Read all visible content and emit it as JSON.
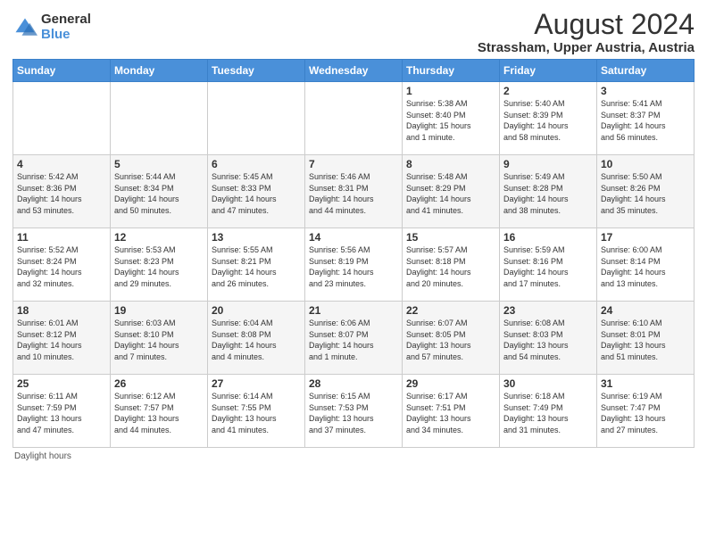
{
  "logo": {
    "general": "General",
    "blue": "Blue"
  },
  "title": "August 2024",
  "subtitle": "Strassham, Upper Austria, Austria",
  "days_of_week": [
    "Sunday",
    "Monday",
    "Tuesday",
    "Wednesday",
    "Thursday",
    "Friday",
    "Saturday"
  ],
  "footer": "Daylight hours",
  "weeks": [
    [
      {
        "day": "",
        "info": ""
      },
      {
        "day": "",
        "info": ""
      },
      {
        "day": "",
        "info": ""
      },
      {
        "day": "",
        "info": ""
      },
      {
        "day": "1",
        "info": "Sunrise: 5:38 AM\nSunset: 8:40 PM\nDaylight: 15 hours\nand 1 minute."
      },
      {
        "day": "2",
        "info": "Sunrise: 5:40 AM\nSunset: 8:39 PM\nDaylight: 14 hours\nand 58 minutes."
      },
      {
        "day": "3",
        "info": "Sunrise: 5:41 AM\nSunset: 8:37 PM\nDaylight: 14 hours\nand 56 minutes."
      }
    ],
    [
      {
        "day": "4",
        "info": "Sunrise: 5:42 AM\nSunset: 8:36 PM\nDaylight: 14 hours\nand 53 minutes."
      },
      {
        "day": "5",
        "info": "Sunrise: 5:44 AM\nSunset: 8:34 PM\nDaylight: 14 hours\nand 50 minutes."
      },
      {
        "day": "6",
        "info": "Sunrise: 5:45 AM\nSunset: 8:33 PM\nDaylight: 14 hours\nand 47 minutes."
      },
      {
        "day": "7",
        "info": "Sunrise: 5:46 AM\nSunset: 8:31 PM\nDaylight: 14 hours\nand 44 minutes."
      },
      {
        "day": "8",
        "info": "Sunrise: 5:48 AM\nSunset: 8:29 PM\nDaylight: 14 hours\nand 41 minutes."
      },
      {
        "day": "9",
        "info": "Sunrise: 5:49 AM\nSunset: 8:28 PM\nDaylight: 14 hours\nand 38 minutes."
      },
      {
        "day": "10",
        "info": "Sunrise: 5:50 AM\nSunset: 8:26 PM\nDaylight: 14 hours\nand 35 minutes."
      }
    ],
    [
      {
        "day": "11",
        "info": "Sunrise: 5:52 AM\nSunset: 8:24 PM\nDaylight: 14 hours\nand 32 minutes."
      },
      {
        "day": "12",
        "info": "Sunrise: 5:53 AM\nSunset: 8:23 PM\nDaylight: 14 hours\nand 29 minutes."
      },
      {
        "day": "13",
        "info": "Sunrise: 5:55 AM\nSunset: 8:21 PM\nDaylight: 14 hours\nand 26 minutes."
      },
      {
        "day": "14",
        "info": "Sunrise: 5:56 AM\nSunset: 8:19 PM\nDaylight: 14 hours\nand 23 minutes."
      },
      {
        "day": "15",
        "info": "Sunrise: 5:57 AM\nSunset: 8:18 PM\nDaylight: 14 hours\nand 20 minutes."
      },
      {
        "day": "16",
        "info": "Sunrise: 5:59 AM\nSunset: 8:16 PM\nDaylight: 14 hours\nand 17 minutes."
      },
      {
        "day": "17",
        "info": "Sunrise: 6:00 AM\nSunset: 8:14 PM\nDaylight: 14 hours\nand 13 minutes."
      }
    ],
    [
      {
        "day": "18",
        "info": "Sunrise: 6:01 AM\nSunset: 8:12 PM\nDaylight: 14 hours\nand 10 minutes."
      },
      {
        "day": "19",
        "info": "Sunrise: 6:03 AM\nSunset: 8:10 PM\nDaylight: 14 hours\nand 7 minutes."
      },
      {
        "day": "20",
        "info": "Sunrise: 6:04 AM\nSunset: 8:08 PM\nDaylight: 14 hours\nand 4 minutes."
      },
      {
        "day": "21",
        "info": "Sunrise: 6:06 AM\nSunset: 8:07 PM\nDaylight: 14 hours\nand 1 minute."
      },
      {
        "day": "22",
        "info": "Sunrise: 6:07 AM\nSunset: 8:05 PM\nDaylight: 13 hours\nand 57 minutes."
      },
      {
        "day": "23",
        "info": "Sunrise: 6:08 AM\nSunset: 8:03 PM\nDaylight: 13 hours\nand 54 minutes."
      },
      {
        "day": "24",
        "info": "Sunrise: 6:10 AM\nSunset: 8:01 PM\nDaylight: 13 hours\nand 51 minutes."
      }
    ],
    [
      {
        "day": "25",
        "info": "Sunrise: 6:11 AM\nSunset: 7:59 PM\nDaylight: 13 hours\nand 47 minutes."
      },
      {
        "day": "26",
        "info": "Sunrise: 6:12 AM\nSunset: 7:57 PM\nDaylight: 13 hours\nand 44 minutes."
      },
      {
        "day": "27",
        "info": "Sunrise: 6:14 AM\nSunset: 7:55 PM\nDaylight: 13 hours\nand 41 minutes."
      },
      {
        "day": "28",
        "info": "Sunrise: 6:15 AM\nSunset: 7:53 PM\nDaylight: 13 hours\nand 37 minutes."
      },
      {
        "day": "29",
        "info": "Sunrise: 6:17 AM\nSunset: 7:51 PM\nDaylight: 13 hours\nand 34 minutes."
      },
      {
        "day": "30",
        "info": "Sunrise: 6:18 AM\nSunset: 7:49 PM\nDaylight: 13 hours\nand 31 minutes."
      },
      {
        "day": "31",
        "info": "Sunrise: 6:19 AM\nSunset: 7:47 PM\nDaylight: 13 hours\nand 27 minutes."
      }
    ]
  ]
}
